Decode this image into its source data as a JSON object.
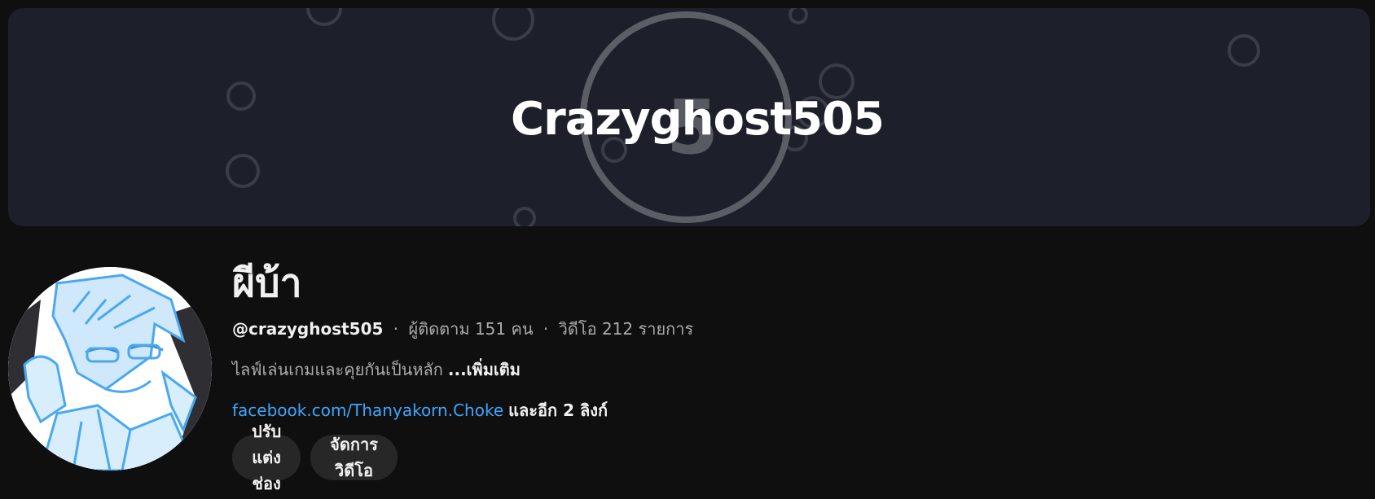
{
  "banner": {
    "title": "Crazyghost505",
    "logo_digit": "5"
  },
  "channel": {
    "name": "ผีบ้า",
    "handle": "@crazyghost505",
    "separator": "·",
    "subscribers": "ผู้ติดตาม 151 คน",
    "videos": "วิดีโอ 212 รายการ",
    "description": "ไลฟ์เล่นเกมและคุยกันเป็นหลัก",
    "more_label": "...เพิ่มเติม",
    "link_text": "facebook.com/Thanyakorn.Choke",
    "extra_links": "และอีก 2 ลิงก์"
  },
  "buttons": {
    "customize": "ปรับแต่งช่อง",
    "manage_videos": "จัดการวิดีโอ"
  },
  "colors": {
    "background": "#0f0f0f",
    "banner": "#1d1f2a",
    "link": "#3ea6ff",
    "button": "#272727",
    "avatar_art": "#4aa8f0"
  }
}
